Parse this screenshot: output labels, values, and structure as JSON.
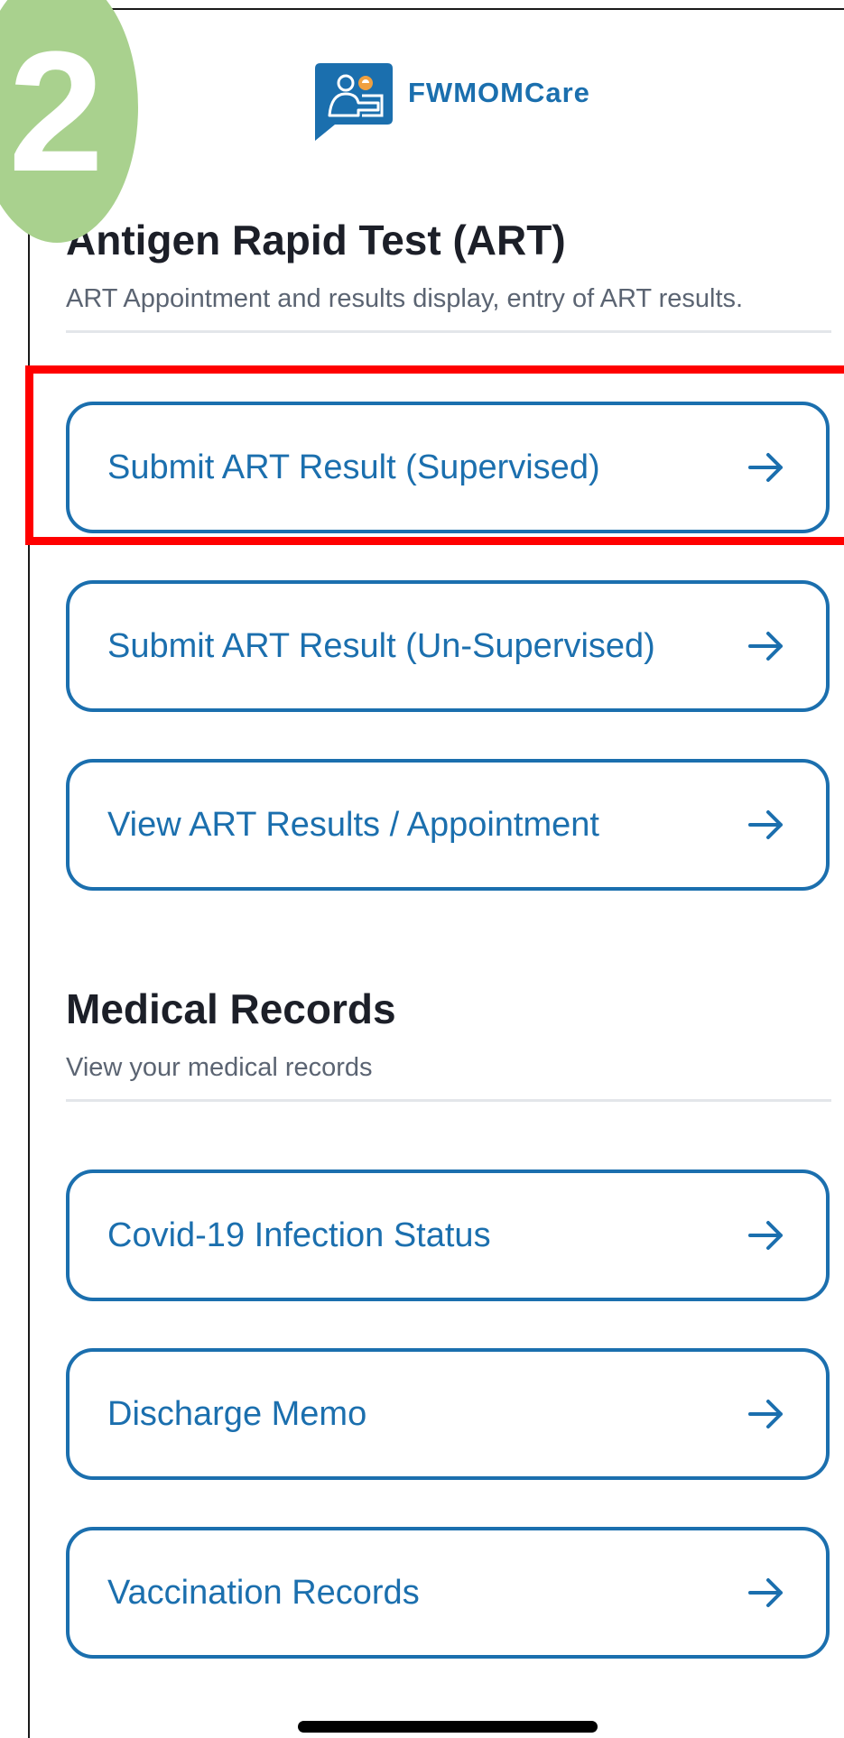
{
  "annotation": {
    "step_number": "2",
    "badge_color": "#a9d18e",
    "highlight_color": "#ff0000"
  },
  "header": {
    "brand_name": "FWMOMCare",
    "logo_icon": "chat-bubble-people-icon",
    "brand_color": "#1b6fae"
  },
  "sections": [
    {
      "title": "Antigen Rapid Test (ART)",
      "subtitle": "ART Appointment and results display, entry of ART results.",
      "items": [
        {
          "label": "Submit ART Result (Supervised)",
          "highlighted": true
        },
        {
          "label": "Submit ART Result (Un-Supervised)"
        },
        {
          "label": "View ART Results / Appointment"
        }
      ]
    },
    {
      "title": "Medical Records",
      "subtitle": "View your medical records",
      "items": [
        {
          "label": "Covid-19 Infection Status"
        },
        {
          "label": "Discharge Memo"
        },
        {
          "label": "Vaccination Records"
        }
      ]
    }
  ]
}
